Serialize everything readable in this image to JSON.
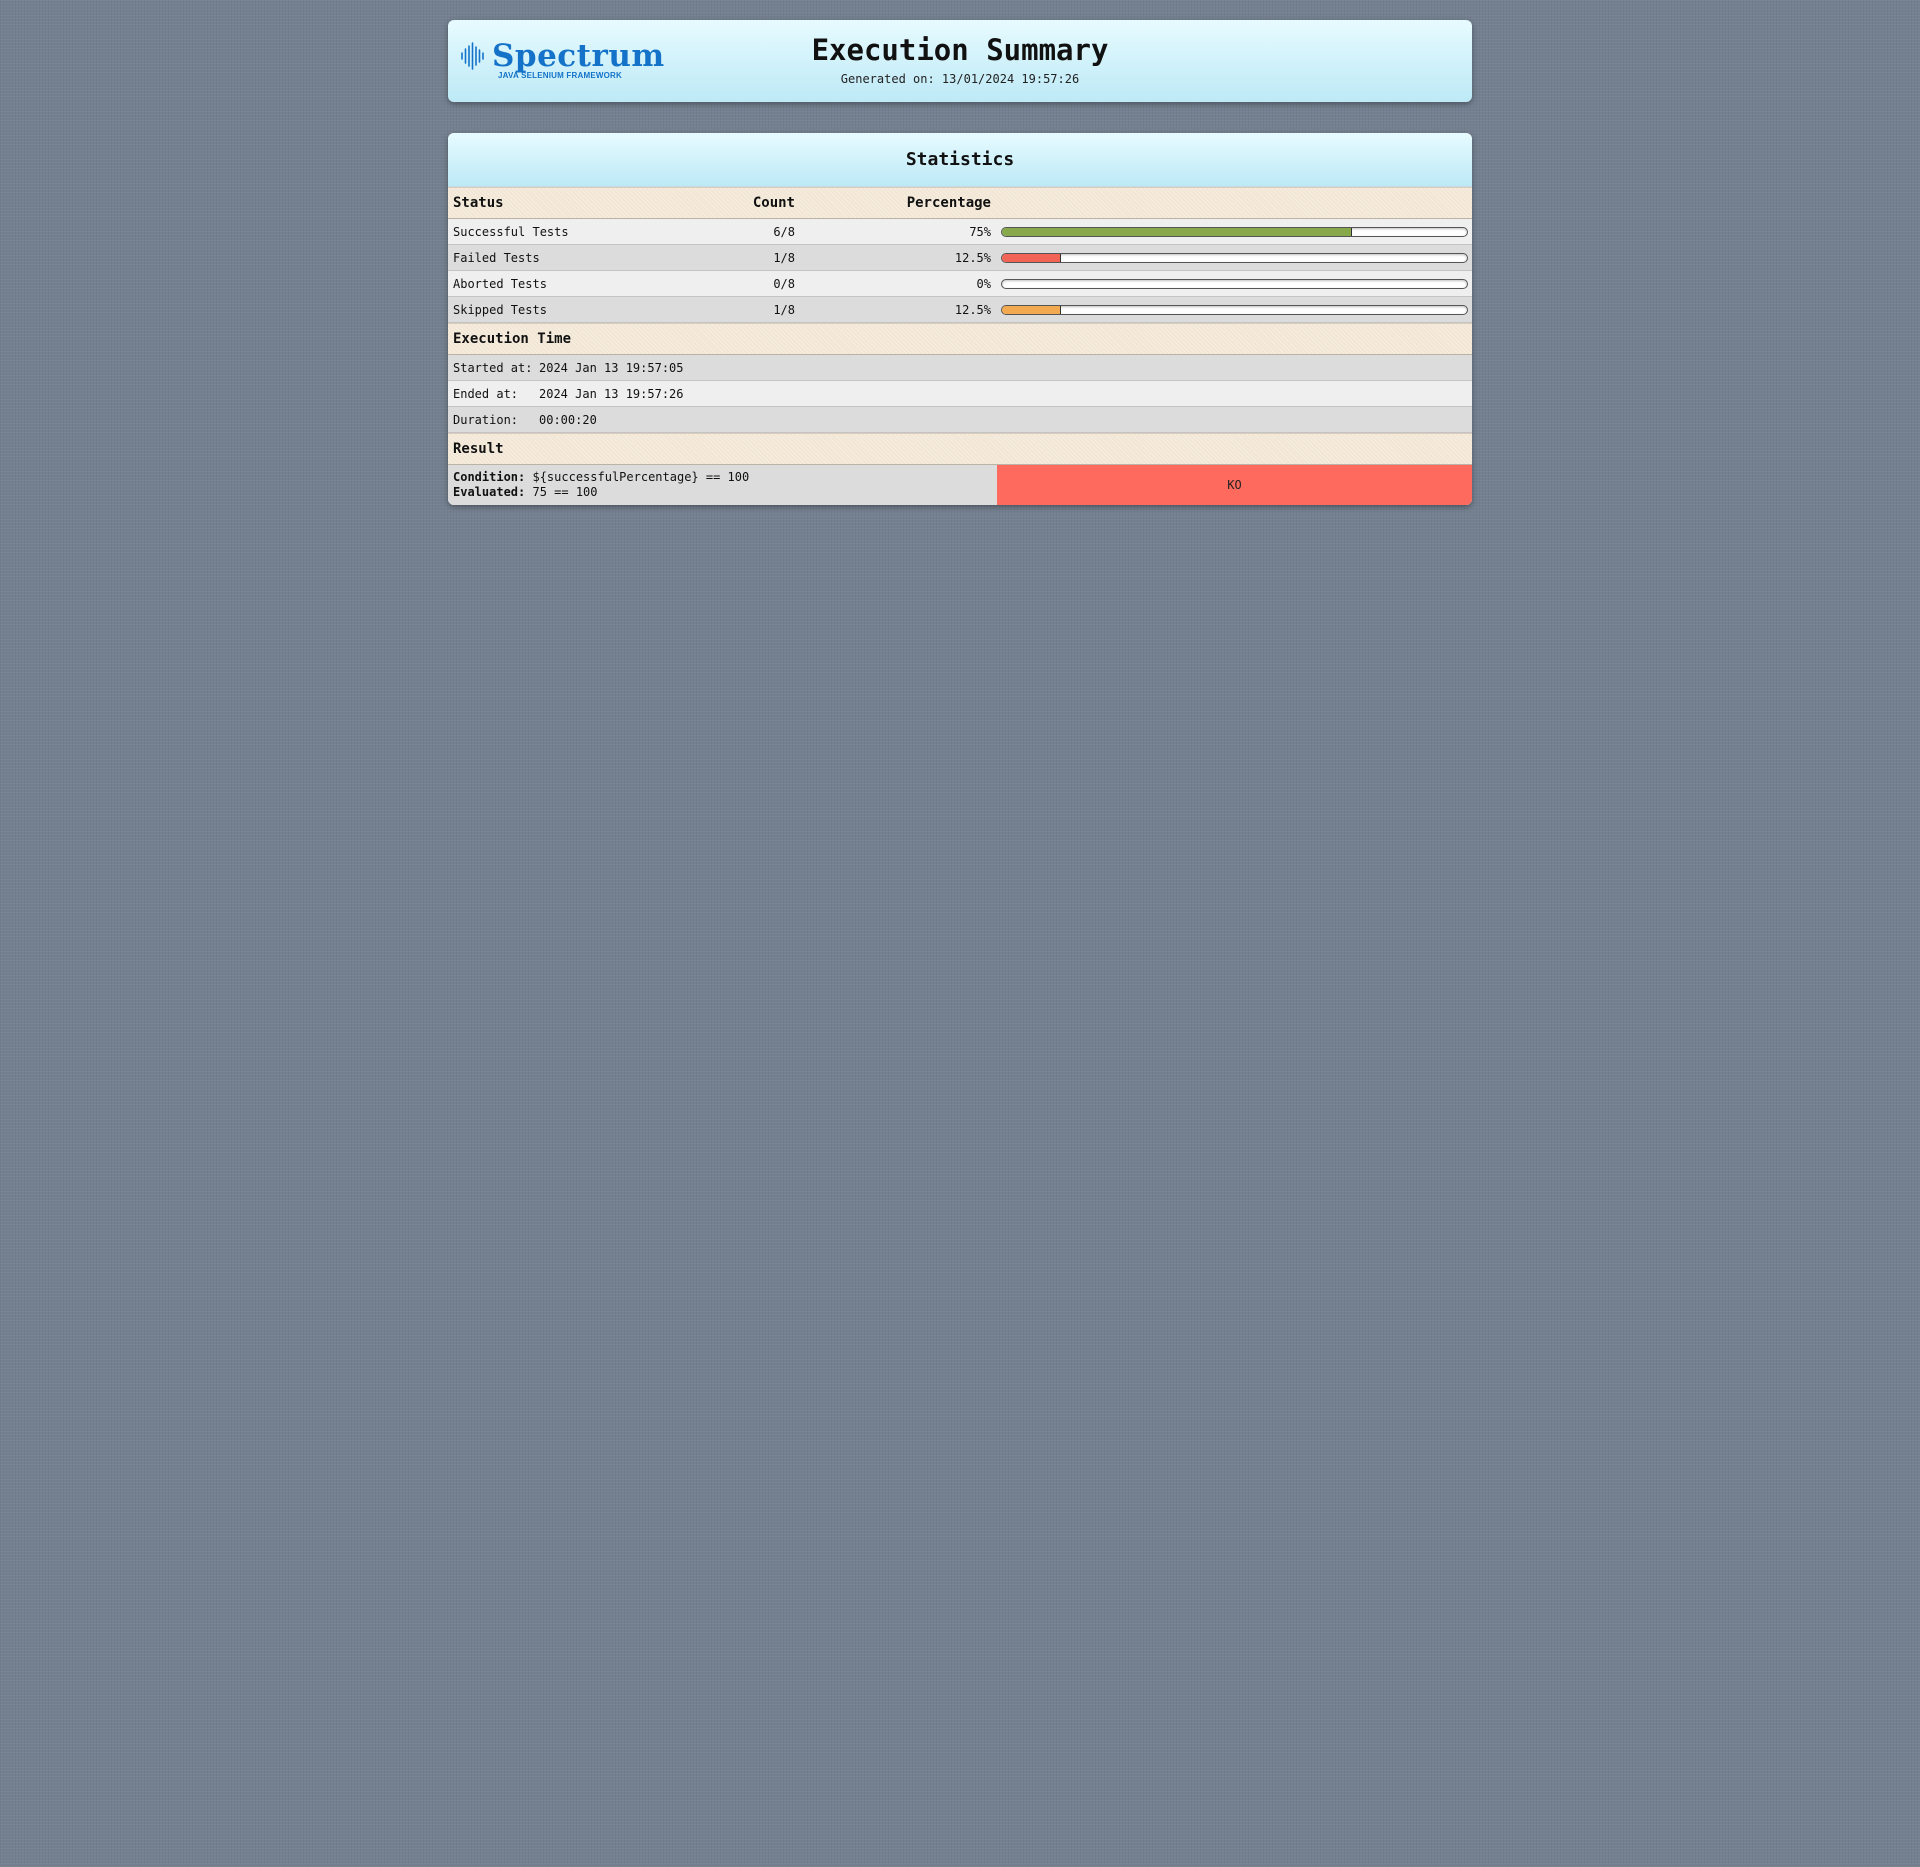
{
  "header": {
    "logo_text": "Spectrum",
    "logo_subtitle": "JAVA SELENIUM FRAMEWORK",
    "title": "Execution Summary",
    "generated_on": "Generated on: 13/01/2024 19:57:26"
  },
  "statistics": {
    "title": "Statistics",
    "columns": {
      "status": "Status",
      "count": "Count",
      "percentage": "Percentage"
    },
    "rows": [
      {
        "status": "Successful Tests",
        "count": "6/8",
        "percentage": "75%",
        "fraction": 0.75,
        "color": "#88a84c"
      },
      {
        "status": "Failed Tests",
        "count": "1/8",
        "percentage": "12.5%",
        "fraction": 0.125,
        "color": "#f26456"
      },
      {
        "status": "Aborted Tests",
        "count": "0/8",
        "percentage": "0%",
        "fraction": 0.0,
        "color": "#9aa4b0"
      },
      {
        "status": "Skipped Tests",
        "count": "1/8",
        "percentage": "12.5%",
        "fraction": 0.125,
        "color": "#f2a950"
      }
    ]
  },
  "execution_time": {
    "heading": "Execution Time",
    "started_label": "Started at:",
    "started_value": "2024 Jan 13 19:57:05",
    "ended_label": "Ended at:",
    "ended_value": "2024 Jan 13 19:57:26",
    "duration_label": "Duration:",
    "duration_value": "00:00:20"
  },
  "result": {
    "heading": "Result",
    "condition_label": "Condition:",
    "condition_value": "${successfulPercentage} == 100",
    "evaluated_label": "Evaluated:",
    "evaluated_value": "75 == 100",
    "outcome": "KO",
    "outcome_color": "#fe6a5e"
  }
}
